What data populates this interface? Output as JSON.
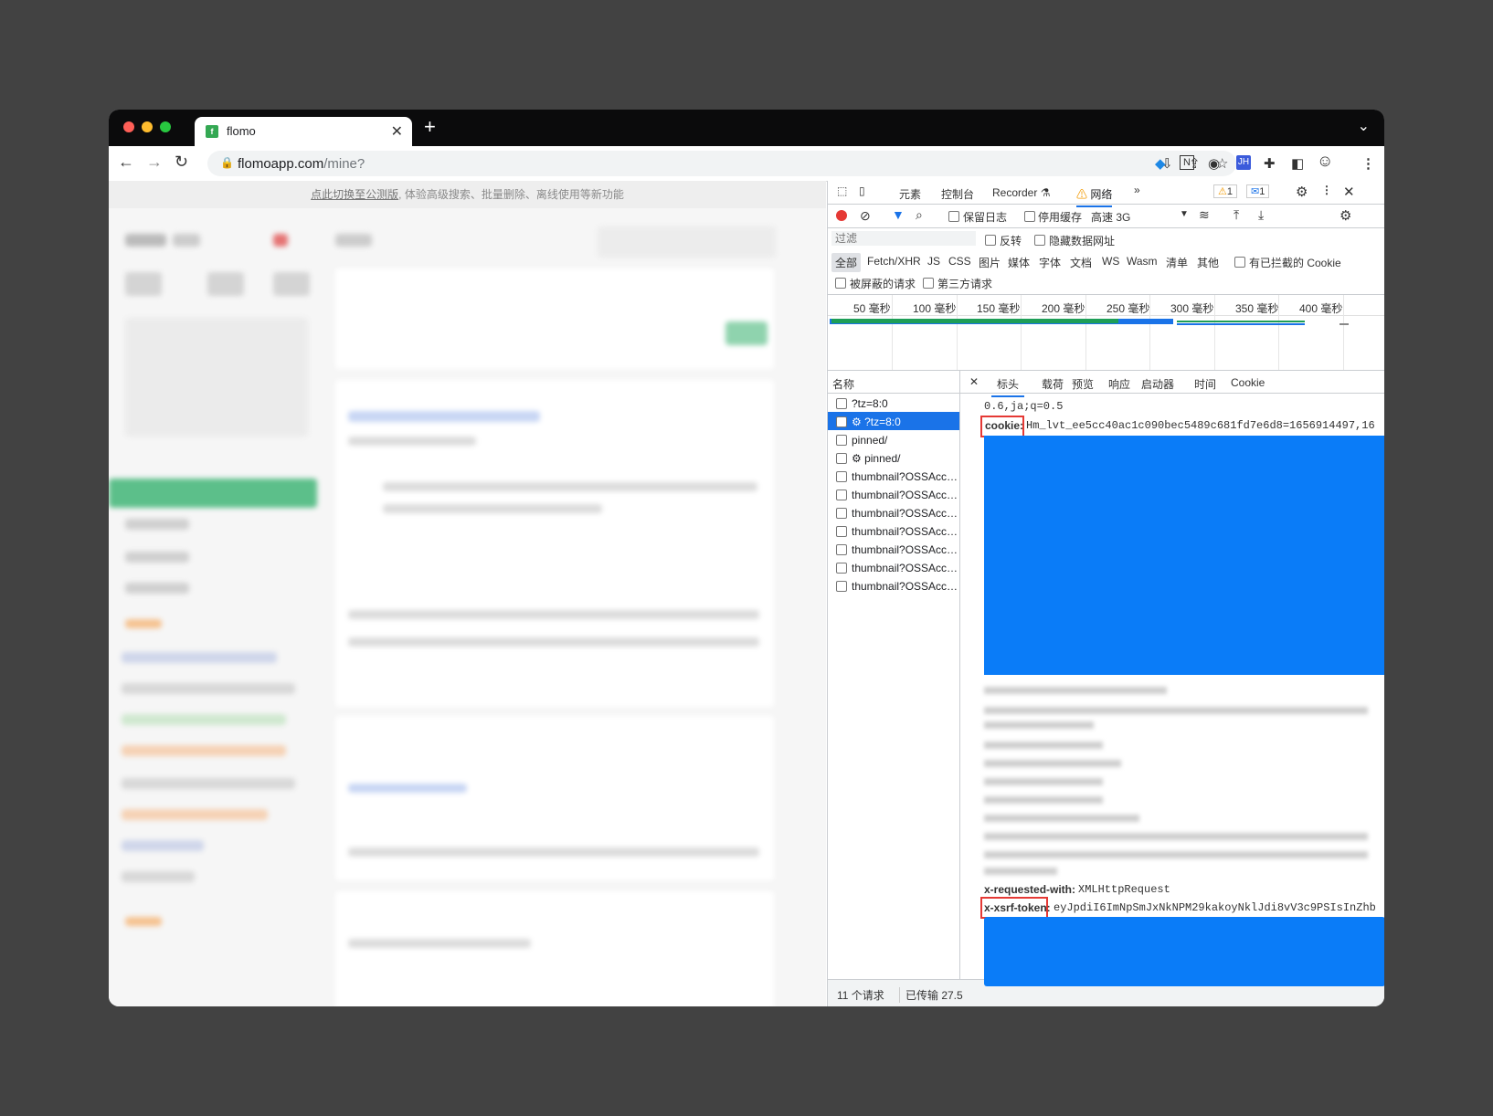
{
  "tab": {
    "title": "flomo",
    "favicon": "f"
  },
  "address": {
    "host": "flomoapp.com",
    "path": "/mine?"
  },
  "banner": {
    "link": "点此切换至公测版",
    "rest": ", 体验高级搜索、批量删除、离线使用等新功能"
  },
  "devtools": {
    "tabs": [
      "元素",
      "控制台",
      "Recorder",
      "网络"
    ],
    "recorder_icon": "flask",
    "network_warning_icon": "warning",
    "more": "»",
    "warn_count": "1",
    "msg_count": "1",
    "toolbar": {
      "preserve_log": "保留日志",
      "disable_cache": "停用缓存",
      "throttle": "高速 3G"
    },
    "filter": {
      "placeholder": "过滤",
      "invert": "反转",
      "hide_data_urls": "隐藏数据网址"
    },
    "types": [
      "全部",
      "Fetch/XHR",
      "JS",
      "CSS",
      "图片",
      "媒体",
      "字体",
      "文档",
      "WS",
      "Wasm",
      "清单",
      "其他"
    ],
    "blocked_cookies": "有已拦截的 Cookie",
    "blocked_requests": "被屏蔽的请求",
    "third_party": "第三方请求",
    "timeline_ticks": [
      "50 毫秒",
      "100 毫秒",
      "150 毫秒",
      "200 毫秒",
      "250 毫秒",
      "300 毫秒",
      "350 毫秒",
      "400 毫秒"
    ],
    "name_header": "名称",
    "requests": [
      {
        "name": "?tz=8:0",
        "selected": false
      },
      {
        "name": "⚙ ?tz=8:0",
        "selected": true
      },
      {
        "name": "pinned/",
        "selected": false
      },
      {
        "name": "⚙ pinned/",
        "selected": false
      },
      {
        "name": "thumbnail?OSSAcc…",
        "selected": false
      },
      {
        "name": "thumbnail?OSSAcc…",
        "selected": false
      },
      {
        "name": "thumbnail?OSSAcc…",
        "selected": false
      },
      {
        "name": "thumbnail?OSSAcc…",
        "selected": false
      },
      {
        "name": "thumbnail?OSSAcc…",
        "selected": false
      },
      {
        "name": "thumbnail?OSSAcc…",
        "selected": false
      },
      {
        "name": "thumbnail?OSSAcc…",
        "selected": false
      }
    ],
    "status": {
      "count": "11 个请求",
      "transferred": "已传输 27.5"
    },
    "detail_tabs": [
      "标头",
      "载荷",
      "预览",
      "响应",
      "启动器",
      "时间",
      "Cookie"
    ],
    "headers": {
      "accept_lang_tail": "0.6,ja;q=0.5",
      "cookie_name": "cookie:",
      "cookie_value": "Hm_lvt_ee5cc40ac1c090bec5489c681fd7e6d8=1656914497,16",
      "xrw_name": "x-requested-with:",
      "xrw_value": "XMLHttpRequest",
      "xsrf_name": "x-xsrf-token:",
      "xsrf_value": "eyJpdiI6ImNpSmJxNkNPM29kakoyNklJdi8vV3c9PSIsInZhb"
    }
  }
}
